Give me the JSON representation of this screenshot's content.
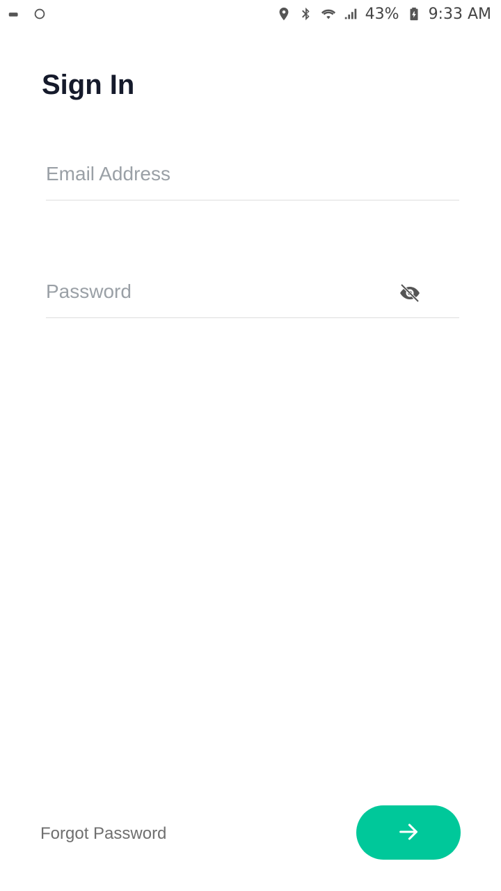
{
  "status_bar": {
    "battery": "43%",
    "time": "9:33 AM",
    "icons": [
      "location-icon",
      "bluetooth-icon",
      "wifi-icon",
      "signal-icon",
      "battery-icon"
    ]
  },
  "page": {
    "title": "Sign In"
  },
  "form": {
    "email_placeholder": "Email Address",
    "password_placeholder": "Password",
    "password_toggle_icon": "eye-off-icon"
  },
  "actions": {
    "forgot_label": "Forgot Password",
    "submit_icon": "arrow-right-icon",
    "accent_color": "#00c89a"
  }
}
